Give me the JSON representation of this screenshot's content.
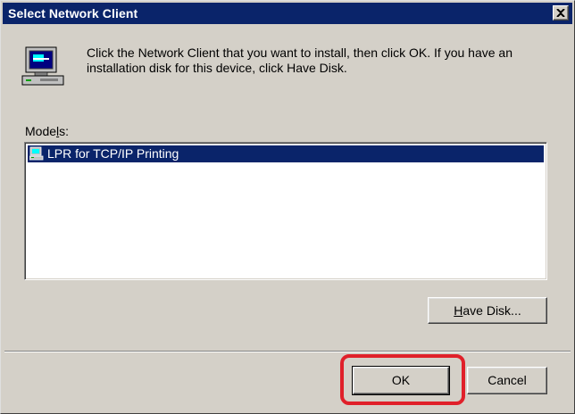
{
  "window": {
    "title": "Select Network Client",
    "close_icon": "close-icon"
  },
  "instructions": "Click the Network Client that you want to install, then click OK. If you have an installation disk for this device, click Have Disk.",
  "models": {
    "label_pre": "Mode",
    "label_accel": "l",
    "label_post": "s:",
    "items": [
      {
        "label": "LPR for TCP/IP Printing",
        "selected": true,
        "icon": "network-client-icon"
      }
    ]
  },
  "buttons": {
    "have_disk_accel": "H",
    "have_disk_rest": "ave Disk...",
    "ok": "OK",
    "cancel": "Cancel"
  },
  "colors": {
    "titlebar": "#0a246a",
    "selection": "#0a246a",
    "face": "#d4d0c8",
    "highlight_ring": "#e0202a"
  }
}
